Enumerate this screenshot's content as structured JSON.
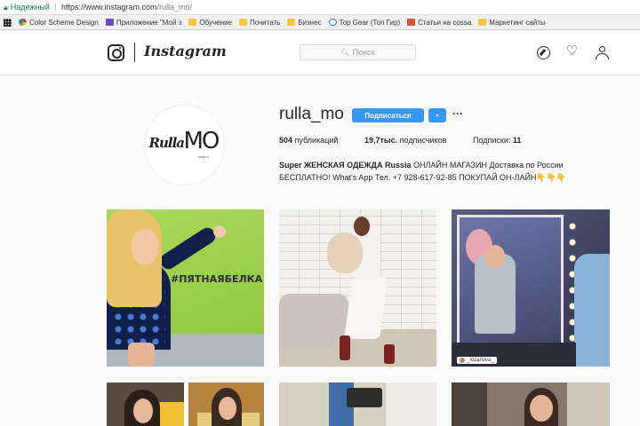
{
  "browser": {
    "secure_label": "Надежный",
    "url_host": "https://www.instagram.com",
    "url_path": "/rulla_mo/",
    "bookmarks": [
      {
        "label": "Color Scheme Design",
        "icon": "color-wheel-icon"
      },
      {
        "label": "Приложение \"Мой з",
        "icon": "app-icon"
      },
      {
        "label": "Обучение",
        "icon": "folder-icon"
      },
      {
        "label": "Почитать",
        "icon": "folder-icon"
      },
      {
        "label": "Бизнес",
        "icon": "folder-icon"
      },
      {
        "label": "Top Gear (Топ Гир)",
        "icon": "topgear-icon"
      },
      {
        "label": "Статьи на cossa",
        "icon": "articles-icon"
      },
      {
        "label": "Маркетинг сайты",
        "icon": "folder-icon"
      }
    ]
  },
  "header": {
    "wordmark": "Instagram",
    "search_placeholder": "Поиск"
  },
  "profile": {
    "username": "rulla_mo",
    "follow_label": "Подписаться",
    "dropdown_glyph": "▾",
    "more_glyph": "···",
    "logo": {
      "rulla": "Rulla",
      "mo": "MO",
      "tag": "rulla.ru"
    },
    "stats": {
      "posts_count": "504",
      "posts_label": "публикаций",
      "followers_count": "19,7тыс.",
      "followers_label": "подписчиков",
      "following_label": "Подписки:",
      "following_count": "11"
    },
    "bio_name": "Super ЖЕНСКАЯ ОДЕЖДА Russia",
    "bio_line1": "ОНЛАЙН МАГАЗИН Доставка по России",
    "bio_line2": "БЕСПЛАТНО! What's App Тел. +7 928-617-92-85 ПОКУПАЙ ОН-ЛАЙН👇👇👇"
  },
  "posts": {
    "post1_sign": "#ПЯТНАЯБЕЛКА",
    "post3_tag": "_lozanova_"
  },
  "colors": {
    "accent": "#3897f0",
    "secure_green": "#0b8043"
  }
}
